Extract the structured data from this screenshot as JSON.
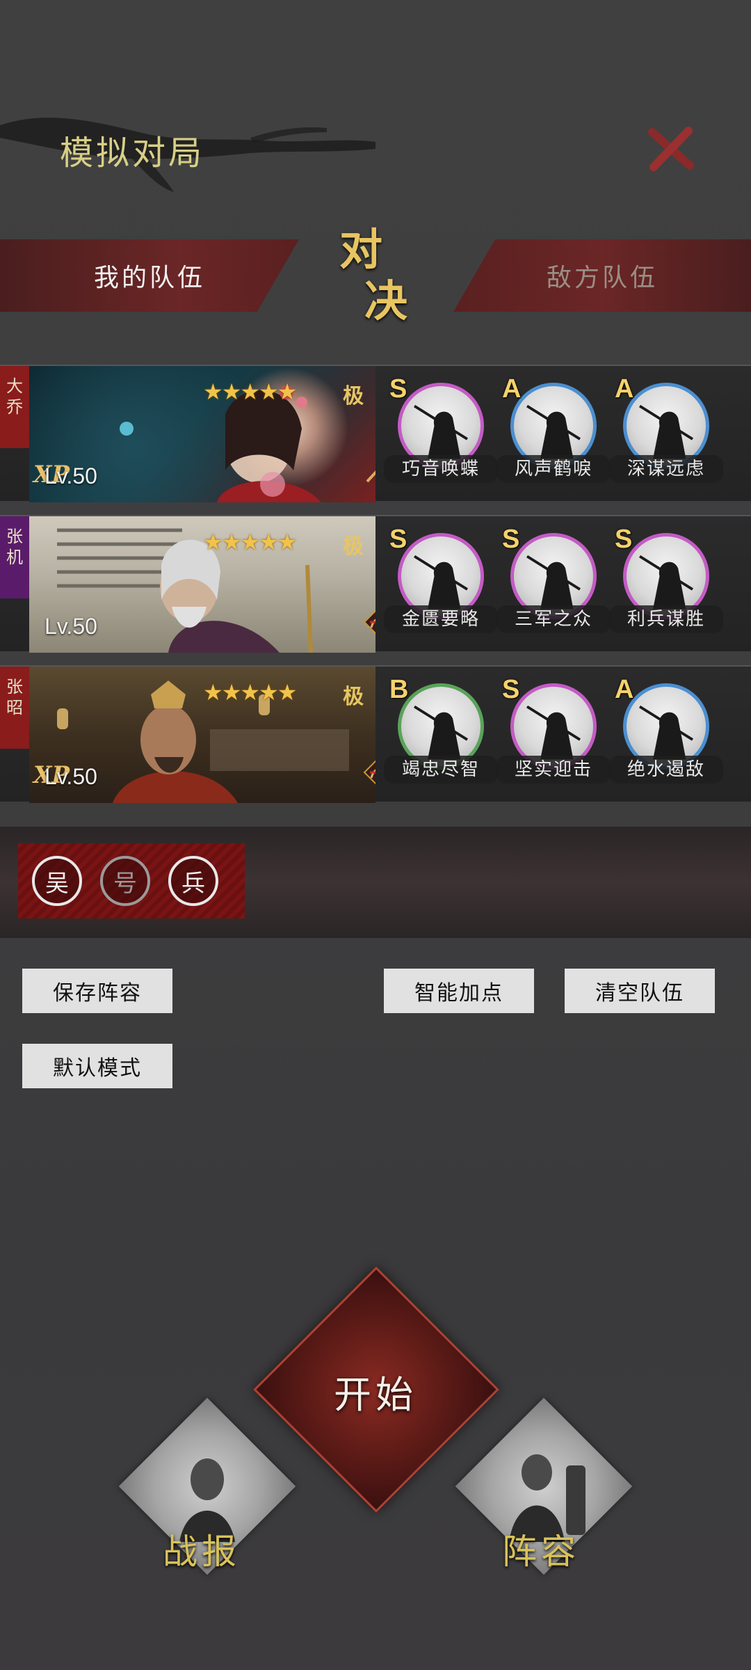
{
  "header": {
    "title": "模拟对局",
    "close_icon": "close-icon"
  },
  "tabs": {
    "mine": "我的队伍",
    "vs_top": "对",
    "vs_bottom": "决",
    "enemy": "敌方队伍"
  },
  "team": [
    {
      "name": "大乔",
      "name_color": "#8a1c1c",
      "stars": "★★★★★",
      "rank": "极",
      "level": "Lv.50",
      "unit_count": "3",
      "unit_icon": "spear-unit-icon",
      "skills": [
        {
          "grade": "S",
          "name": "巧音唤蝶",
          "ring": "#c45bc4"
        },
        {
          "grade": "A",
          "name": "风声鹤唳",
          "ring": "#4b8fd0"
        },
        {
          "grade": "A",
          "name": "深谋远虑",
          "ring": "#4b8fd0"
        }
      ]
    },
    {
      "name": "张机",
      "name_color": "#5a1c6a",
      "stars": "★★★★★",
      "rank": "极",
      "level": "Lv.50",
      "unit_count": "3",
      "unit_icon": "bow-unit-icon",
      "skills": [
        {
          "grade": "S",
          "name": "金匮要略",
          "ring": "#c45bc4"
        },
        {
          "grade": "S",
          "name": "三军之众",
          "ring": "#c45bc4"
        },
        {
          "grade": "S",
          "name": "利兵谋胜",
          "ring": "#c45bc4"
        }
      ]
    },
    {
      "name": "张昭",
      "name_color": "#8a1c1c",
      "stars": "★★★★★",
      "rank": "极",
      "level": "Lv.50",
      "unit_count": "3",
      "unit_icon": "bow-unit-icon",
      "skills": [
        {
          "grade": "B",
          "name": "竭忠尽智",
          "ring": "#5aa35a"
        },
        {
          "grade": "S",
          "name": "坚实迎击",
          "ring": "#c45bc4"
        },
        {
          "grade": "A",
          "name": "绝水遏敌",
          "ring": "#4b8fd0"
        }
      ]
    }
  ],
  "traits": [
    {
      "label": "吴",
      "color": "#e8e8e8"
    },
    {
      "label": "号",
      "color": "#9a9a9a"
    },
    {
      "label": "兵",
      "color": "#e8e8e8"
    }
  ],
  "buttons": {
    "save": "保存阵容",
    "smart": "智能加点",
    "clear": "清空队伍",
    "mode": "默认模式"
  },
  "bottom": {
    "start": "开始",
    "report": "战报",
    "lineup": "阵容"
  },
  "colors": {
    "accent_gold": "#d8cf86",
    "tab_red": "#6b2626"
  }
}
